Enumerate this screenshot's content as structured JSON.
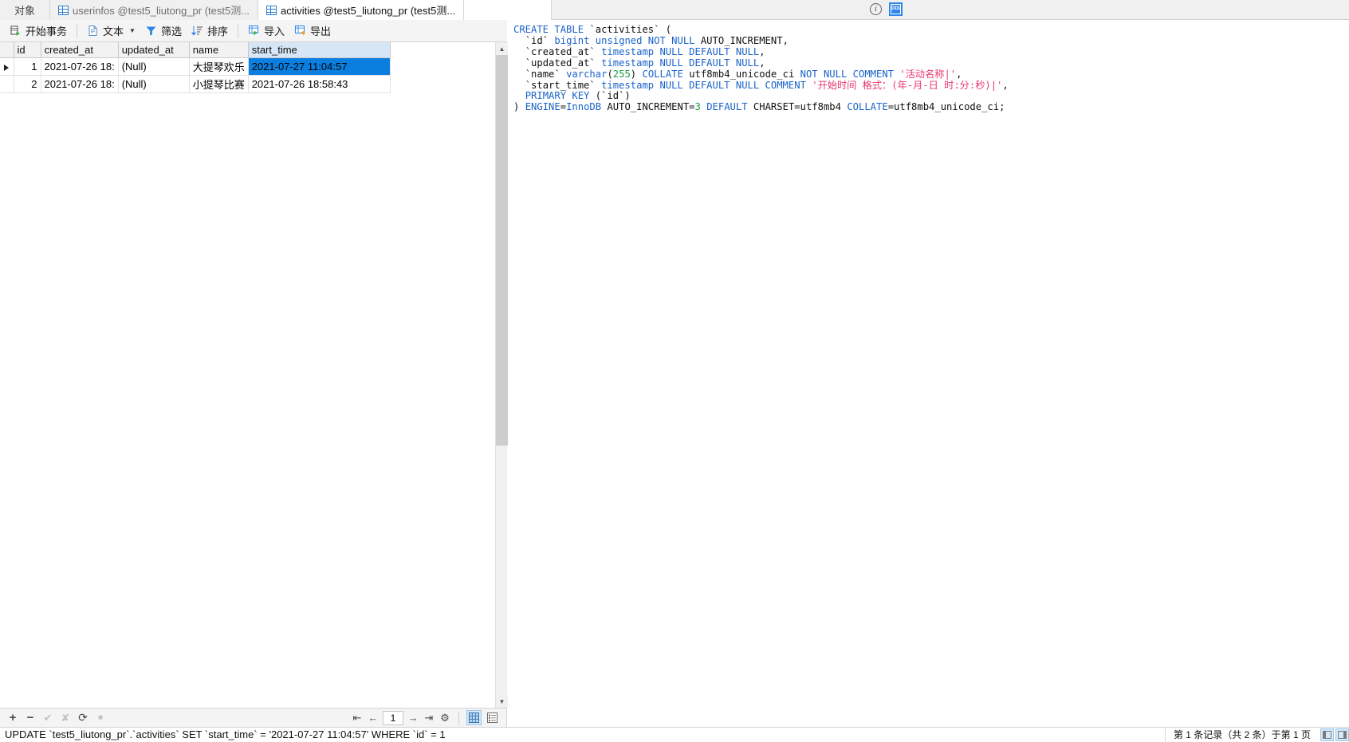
{
  "tabs": [
    {
      "label": "对象",
      "icon": null,
      "active": false,
      "first": true
    },
    {
      "label": "userinfos @test5_liutong_pr (test5测...",
      "icon": "table-grid-icon",
      "active": false
    },
    {
      "label": "activities @test5_liutong_pr (test5测...",
      "icon": "table-grid-icon",
      "active": true
    }
  ],
  "toolbar": {
    "begin_transaction": "开始事务",
    "text": "文本",
    "filter": "筛选",
    "sort": "排序",
    "import": "导入",
    "export": "导出"
  },
  "grid": {
    "columns": [
      "id",
      "created_at",
      "updated_at",
      "name",
      "start_time"
    ],
    "selected_column": "start_time",
    "rows": [
      {
        "marker": true,
        "id": "1",
        "created_at": "2021-07-26 18:",
        "updated_at": "(Null)",
        "name": "大提琴欢乐",
        "start_time": "2021-07-27 11:04:57",
        "selected": "start_time"
      },
      {
        "marker": false,
        "id": "2",
        "created_at": "2021-07-26 18:",
        "updated_at": "(Null)",
        "name": "小提琴比赛",
        "start_time": "2021-07-26 18:58:43",
        "selected": null
      }
    ]
  },
  "grid_footer": {
    "add": "+",
    "remove": "−",
    "confirm": "✔",
    "cancel": "✘",
    "refresh": "⟳",
    "stop": "■",
    "first": "⇤",
    "prev": "←",
    "page": "1",
    "next": "→",
    "last": "⇥",
    "settings": "⚙",
    "grid_view": "grid-view-icon",
    "form_view": "form-view-icon"
  },
  "status": {
    "sql": "UPDATE `test5_liutong_pr`.`activities` SET `start_time` = '2021-07-27 11:04:57' WHERE `id` = 1",
    "record_info": "第 1 条记录（共 2 条）于第 1 页"
  },
  "ddl": {
    "info_icon": "i",
    "ddl_icon": "DDL",
    "code_lines": [
      "CREATE TABLE `activities` (",
      "  `id` bigint unsigned NOT NULL AUTO_INCREMENT,",
      "  `created_at` timestamp NULL DEFAULT NULL,",
      "  `updated_at` timestamp NULL DEFAULT NULL,",
      "  `name` varchar(255) COLLATE utf8mb4_unicode_ci NOT NULL COMMENT '活动名称|',",
      "  `start_time` timestamp NULL DEFAULT NULL COMMENT '开始时间 格式：(年-月-日 时:分:秒)|',",
      "  PRIMARY KEY (`id`)",
      ") ENGINE=InnoDB AUTO_INCREMENT=3 DEFAULT CHARSET=utf8mb4 COLLATE=utf8mb4_unicode_ci;"
    ]
  },
  "colors": {
    "keyword": "#1a63c8",
    "number": "#1a9e3c",
    "string": "#e8396e",
    "selection": "#0b7fe0",
    "header_selected": "#d6e6f7",
    "accent": "#2f86e8"
  }
}
